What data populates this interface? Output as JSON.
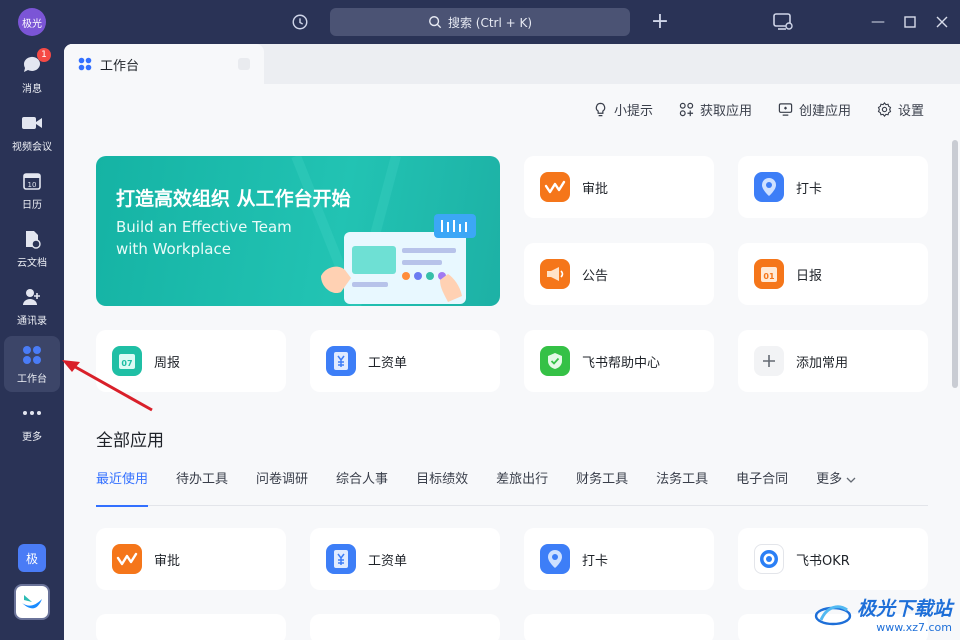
{
  "titlebar": {
    "avatar_text": "极光",
    "search_placeholder": "搜索 (Ctrl + K)"
  },
  "sidebar": {
    "items": [
      {
        "label": "消息",
        "icon": "chat-icon",
        "badge": "1"
      },
      {
        "label": "视频会议",
        "icon": "video-icon"
      },
      {
        "label": "日历",
        "icon": "calendar-icon",
        "day": "10"
      },
      {
        "label": "云文档",
        "icon": "doc-icon"
      },
      {
        "label": "通讯录",
        "icon": "contacts-icon"
      },
      {
        "label": "工作台",
        "icon": "workplace-icon",
        "active": true
      },
      {
        "label": "更多",
        "icon": "more-icon"
      }
    ],
    "bottom_badge": "极"
  },
  "tab": {
    "label": "工作台"
  },
  "toplinks": [
    {
      "label": "小提示",
      "icon": "bulb-icon"
    },
    {
      "label": "获取应用",
      "icon": "apps-add-icon"
    },
    {
      "label": "创建应用",
      "icon": "create-app-icon"
    },
    {
      "label": "设置",
      "icon": "gear-icon"
    }
  ],
  "banner": {
    "title": "打造高效组织 从工作台开始",
    "subtitle_line1": "Build an Effective Team",
    "subtitle_line2": "with Workplace"
  },
  "common_apps": [
    {
      "label": "审批",
      "icon": "approval-icon",
      "color": "#f5761a"
    },
    {
      "label": "打卡",
      "icon": "checkin-icon",
      "color": "#3d7ef7"
    },
    {
      "label": "公告",
      "icon": "announcement-icon",
      "color": "#f5761a"
    },
    {
      "label": "日报",
      "icon": "daily-report-icon",
      "color": "#f5761a",
      "day": "01"
    },
    {
      "label": "周报",
      "icon": "weekly-report-icon",
      "color": "#1fbfa5",
      "day": "07"
    },
    {
      "label": "工资单",
      "icon": "payslip-icon",
      "color": "#3d7ef7"
    },
    {
      "label": "飞书帮助中心",
      "icon": "help-center-icon",
      "color": "#35c146"
    },
    {
      "label": "添加常用",
      "icon": "plus-icon"
    }
  ],
  "all_apps": {
    "title": "全部应用",
    "categories": [
      "最近使用",
      "待办工具",
      "问卷调研",
      "综合人事",
      "目标绩效",
      "差旅出行",
      "财务工具",
      "法务工具",
      "电子合同",
      "更多"
    ],
    "active_category": "最近使用",
    "apps": [
      {
        "label": "审批",
        "icon": "approval-icon",
        "color": "#f5761a"
      },
      {
        "label": "工资单",
        "icon": "payslip-icon",
        "color": "#3d7ef7"
      },
      {
        "label": "打卡",
        "icon": "checkin-icon",
        "color": "#3d7ef7"
      },
      {
        "label": "飞书OKR",
        "icon": "okr-icon",
        "color": "#2b7ff5"
      }
    ]
  },
  "watermark": {
    "main": "极光下载站",
    "url": "www.xz7.com"
  }
}
